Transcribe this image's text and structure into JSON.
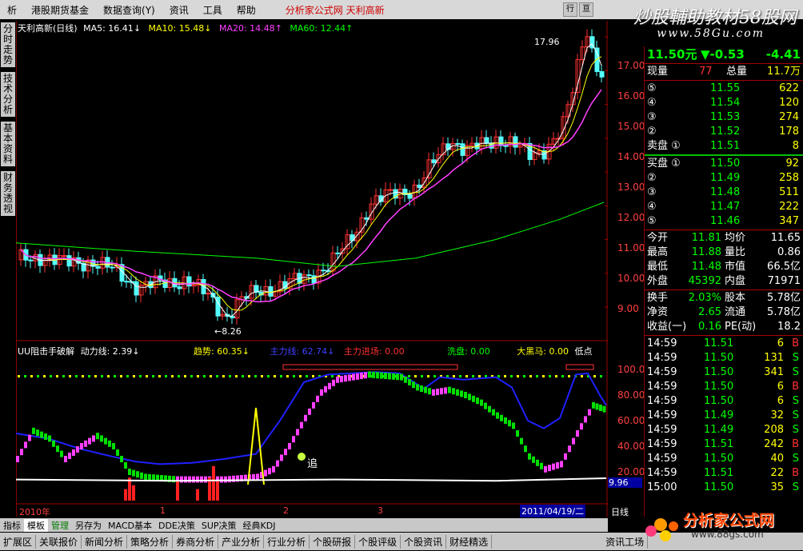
{
  "menu": {
    "items": [
      "析",
      "港股期货基金",
      "数据查询(Y)",
      "资讯",
      "工具",
      "帮助"
    ],
    "promo": "分析家公式网  天利高新",
    "mini_buttons": [
      "行",
      "亘"
    ]
  },
  "watermark": {
    "line1": "炒股輔助教材58股网",
    "line2": "www.58Gu.com"
  },
  "side_tabs": [
    "分时走势",
    "技术分析",
    "基本资料",
    "财务透视"
  ],
  "main_legend": {
    "title": "天利高新(日线)",
    "ma5": "MA5: 16.41",
    "ma10": "MA10: 15.48",
    "ma20": "MA20: 14.48",
    "ma60": "MA60: 12.44"
  },
  "colors": {
    "ma5": "#ffffff",
    "ma10": "#ffff00",
    "ma20": "#ff40ff",
    "ma60": "#00ff00",
    "up": "#ff3030",
    "down": "#54ffff",
    "axis": "#a00000"
  },
  "annotations": {
    "high": "17.96",
    "low": "8.26",
    "ind_value": "9.96",
    "chase": "追"
  },
  "price_axis": [
    "17.00",
    "16.00",
    "15.00",
    "14.00",
    "13.00",
    "12.00",
    "11.00",
    "10.00",
    "9.00"
  ],
  "ind_axis": [
    "100.00",
    "80.00",
    "60.00",
    "40.00",
    "20.00"
  ],
  "indicator_legend": {
    "name": "UU阻击手破解",
    "power": "动力线: 2.39",
    "trend": "趋势: 60.35",
    "main_rise": "主力线: 62.74",
    "main_in": "主力进场: 0.00",
    "wash": "洗盘: 0.00",
    "horse": "大黑马: 0.00",
    "low": "低点"
  },
  "time_axis": {
    "year": "2010年",
    "ticks": [
      "1",
      "2",
      "3"
    ],
    "cursor_date": "2011/04/19/二",
    "period": "日线"
  },
  "quote": {
    "price": "11.50元",
    "change": "▼-0.53",
    "pct": "-4.41",
    "now_label": "现量",
    "now_val": "77",
    "total_label": "总量",
    "total_val": "11.7万",
    "sell": [
      {
        "lvl": "⑤",
        "price": "11.55",
        "vol": "622"
      },
      {
        "lvl": "④",
        "price": "11.54",
        "vol": "120"
      },
      {
        "lvl": "③",
        "price": "11.53",
        "vol": "274"
      },
      {
        "lvl": "②",
        "price": "11.52",
        "vol": "178"
      },
      {
        "lvl": "卖盘 ①",
        "price": "11.51",
        "vol": "8"
      }
    ],
    "buy": [
      {
        "lvl": "买盘 ①",
        "price": "11.50",
        "vol": "92"
      },
      {
        "lvl": "②",
        "price": "11.49",
        "vol": "258"
      },
      {
        "lvl": "③",
        "price": "11.48",
        "vol": "511"
      },
      {
        "lvl": "④",
        "price": "11.47",
        "vol": "222"
      },
      {
        "lvl": "⑤",
        "price": "11.46",
        "vol": "347"
      }
    ],
    "stats": [
      {
        "l1": "今开",
        "v1": "11.81",
        "l2": "均价",
        "v2": "11.65"
      },
      {
        "l1": "最高",
        "v1": "11.88",
        "l2": "量比",
        "v2": "0.86"
      },
      {
        "l1": "最低",
        "v1": "11.48",
        "l2": "市值",
        "v2": "66.5亿"
      },
      {
        "l1": "外盘",
        "v1": "45392",
        "l2": "内盘",
        "v2": "71971"
      }
    ],
    "stats2": [
      {
        "l1": "换手",
        "v1": "2.03%",
        "l2": "股本",
        "v2": "5.78亿"
      },
      {
        "l1": "净资",
        "v1": "2.65",
        "l2": "流通",
        "v2": "5.78亿"
      },
      {
        "l1": "收益(一)",
        "v1": "0.16",
        "l2": "PE(动)",
        "v2": "18.2"
      }
    ],
    "ticks": [
      {
        "t": "14:59",
        "p": "11.51",
        "v": "6",
        "s": "B"
      },
      {
        "t": "14:59",
        "p": "11.50",
        "v": "131",
        "s": "S"
      },
      {
        "t": "14:59",
        "p": "11.50",
        "v": "341",
        "s": "S"
      },
      {
        "t": "14:59",
        "p": "11.50",
        "v": "6",
        "s": "B"
      },
      {
        "t": "14:59",
        "p": "11.50",
        "v": "6",
        "s": "S"
      },
      {
        "t": "14:59",
        "p": "11.49",
        "v": "32",
        "s": "S"
      },
      {
        "t": "14:59",
        "p": "11.49",
        "v": "208",
        "s": "S"
      },
      {
        "t": "14:59",
        "p": "11.51",
        "v": "242",
        "s": "B"
      },
      {
        "t": "14:59",
        "p": "11.50",
        "v": "40",
        "s": "S"
      },
      {
        "t": "14:59",
        "p": "11.51",
        "v": "22",
        "s": "B"
      },
      {
        "t": "15:00",
        "p": "11.50",
        "v": "35",
        "s": "S"
      }
    ]
  },
  "bottom_tabs": [
    "指标",
    "模板",
    "管理",
    "另存为",
    "MACD基本",
    "DDE决策",
    "SUP决策",
    "经典KDJ"
  ],
  "bottom_nav": [
    "扩展区",
    "关联报价",
    "新闻分析",
    "策略分析",
    "券商分析",
    "产业分析",
    "行业分析",
    "个股研报",
    "个股评级",
    "个股资讯",
    "财经精选"
  ],
  "bottom_right": "资讯工场",
  "logo": {
    "line1": "分析家公式网",
    "line2": "www.88gs.com"
  }
}
